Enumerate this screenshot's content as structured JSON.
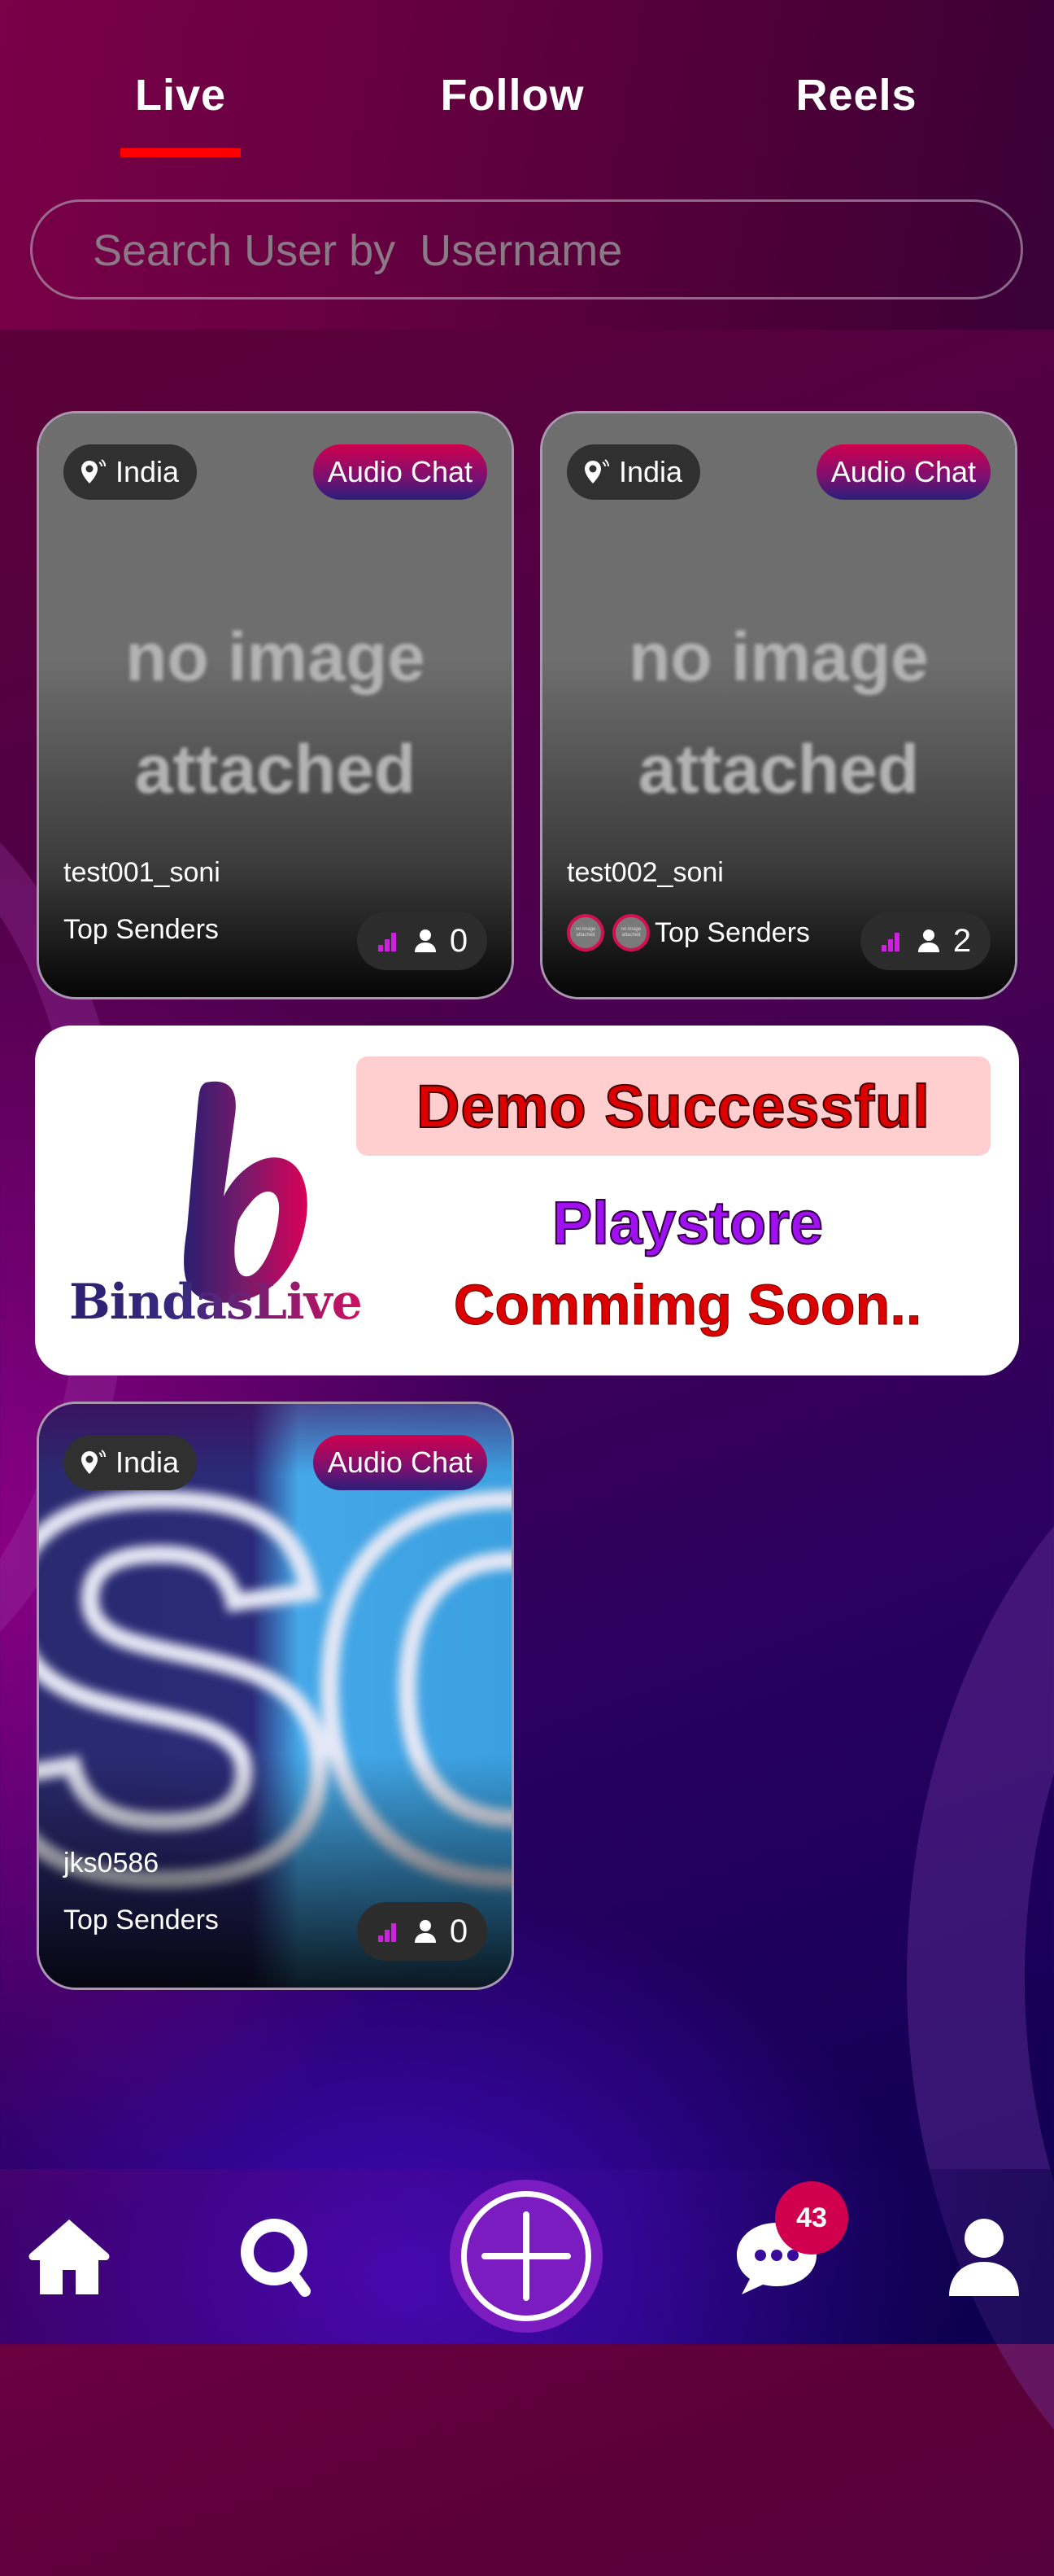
{
  "tabs": [
    {
      "label": "Live",
      "active": true
    },
    {
      "label": "Follow",
      "active": false
    },
    {
      "label": "Reels",
      "active": false
    }
  ],
  "colors": {
    "tab_indicator": "#ff0000",
    "audio_chat_gradient_top": "#d0004e",
    "audio_chat_gradient_bottom": "#2a1e7a",
    "badge": "#d0004e",
    "plus_button": "#7a1cc0",
    "signal_bars": "#cc22dd"
  },
  "search": {
    "placeholder": "Search User by  Username",
    "value": ""
  },
  "cards": [
    {
      "country": "India",
      "type_label": "Audio Chat",
      "thumbnail": "no image attached",
      "thumbnail_line1": "no image",
      "thumbnail_line2": "attached",
      "username": "test001_soni",
      "senders_label": "Top Senders",
      "top_senders": [],
      "viewers": "0"
    },
    {
      "country": "India",
      "type_label": "Audio Chat",
      "thumbnail": "no image attached",
      "thumbnail_line1": "no image",
      "thumbnail_line2": "attached",
      "username": "test002_soni",
      "senders_label": "Top Senders",
      "top_senders": [
        "no image attached",
        "no image attached"
      ],
      "viewers": "2"
    },
    {
      "country": "India",
      "type_label": "Audio Chat",
      "thumbnail": "SC logo",
      "thumbnail_text": "SC",
      "username": "jks0586",
      "senders_label": "Top Senders",
      "top_senders": [],
      "viewers": "0"
    }
  ],
  "banner": {
    "logo_letter": "b",
    "brand": "BindasLive",
    "headline": "Demo Successful",
    "line2": "Playstore",
    "line3": "Commimg Soon.."
  },
  "sender_avatar_text": "no image attached",
  "bottom_nav": {
    "items": [
      {
        "name": "home",
        "icon": "home-icon"
      },
      {
        "name": "search",
        "icon": "search-icon"
      },
      {
        "name": "go-live",
        "icon": "plus-circle-icon"
      },
      {
        "name": "messages",
        "icon": "chat-bubble-icon",
        "badge": "43"
      },
      {
        "name": "profile",
        "icon": "user-icon"
      }
    ]
  }
}
